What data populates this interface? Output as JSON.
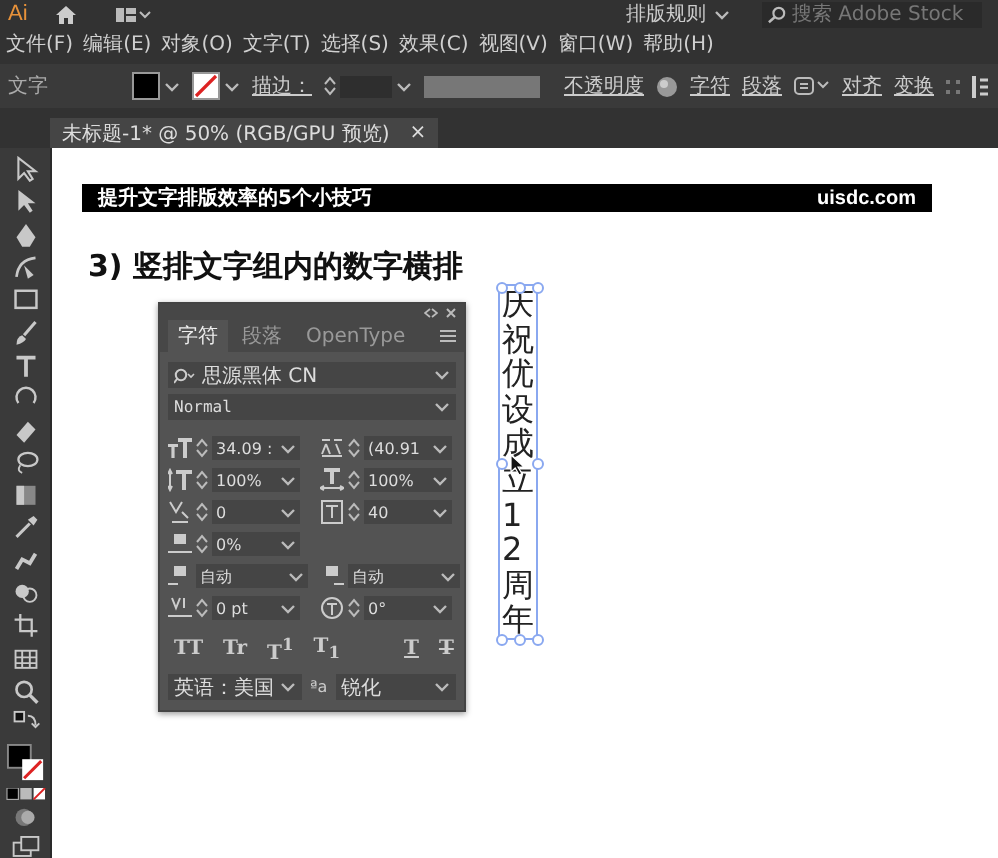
{
  "app": {
    "logo": "Ai",
    "workspace": "排版规则",
    "search": {
      "placeholder": "搜索 Adobe Stock"
    }
  },
  "menu": [
    "文件(F)",
    "编辑(E)",
    "对象(O)",
    "文字(T)",
    "选择(S)",
    "效果(C)",
    "视图(V)",
    "窗口(W)",
    "帮助(H)"
  ],
  "control_bar": {
    "label": "文字",
    "stroke_label": "描边：",
    "opacity_link": "不透明度",
    "links": [
      "字符",
      "段落"
    ],
    "links_right": [
      "对齐",
      "变换"
    ]
  },
  "document_tab": {
    "title": "未标题-1* @ 50% (RGB/GPU 预览)",
    "close": "×"
  },
  "artboard": {
    "banner": {
      "title": "提升文字排版效率的5个小技巧",
      "site": "uisdc.com"
    },
    "heading": "3) 竖排文字组内的数字横排",
    "vertical_text": "庆祝优设成立12周年",
    "selected": true
  },
  "character_panel": {
    "tabs": [
      {
        "label": "字符",
        "selected": true
      },
      {
        "label": "段落",
        "selected": false
      },
      {
        "label": "OpenType",
        "selected": false
      }
    ],
    "font": "思源黑体 CN",
    "style": "Normal",
    "fields": [
      {
        "kind": "size",
        "value": "34.09 :"
      },
      {
        "kind": "leading",
        "value": "(40.91"
      },
      {
        "kind": "vscale",
        "value": "100%"
      },
      {
        "kind": "hscale",
        "value": "100%"
      },
      {
        "kind": "kerning",
        "value": "0"
      },
      {
        "kind": "tracking",
        "value": "40"
      },
      {
        "kind": "tsume",
        "value": "0%"
      },
      {
        "kind": "aki_left",
        "value": "自动"
      },
      {
        "kind": "aki_right",
        "value": "自动"
      },
      {
        "kind": "baseline",
        "value": "0 pt"
      },
      {
        "kind": "rotation",
        "value": "0°"
      }
    ],
    "style_buttons": [
      {
        "kind": "plain",
        "label": "TT"
      },
      {
        "kind": "plain",
        "label": "Tr"
      },
      {
        "kind": "plain",
        "label": "T$^{1}$"
      },
      {
        "kind": "plain",
        "label": "T$_{1}$"
      },
      {
        "kind": "underline",
        "label": "T"
      },
      {
        "kind": "strike",
        "label": "T"
      }
    ],
    "language": "英语：美国",
    "anti_alias_label": "ªa",
    "anti_alias": "锐化"
  }
}
